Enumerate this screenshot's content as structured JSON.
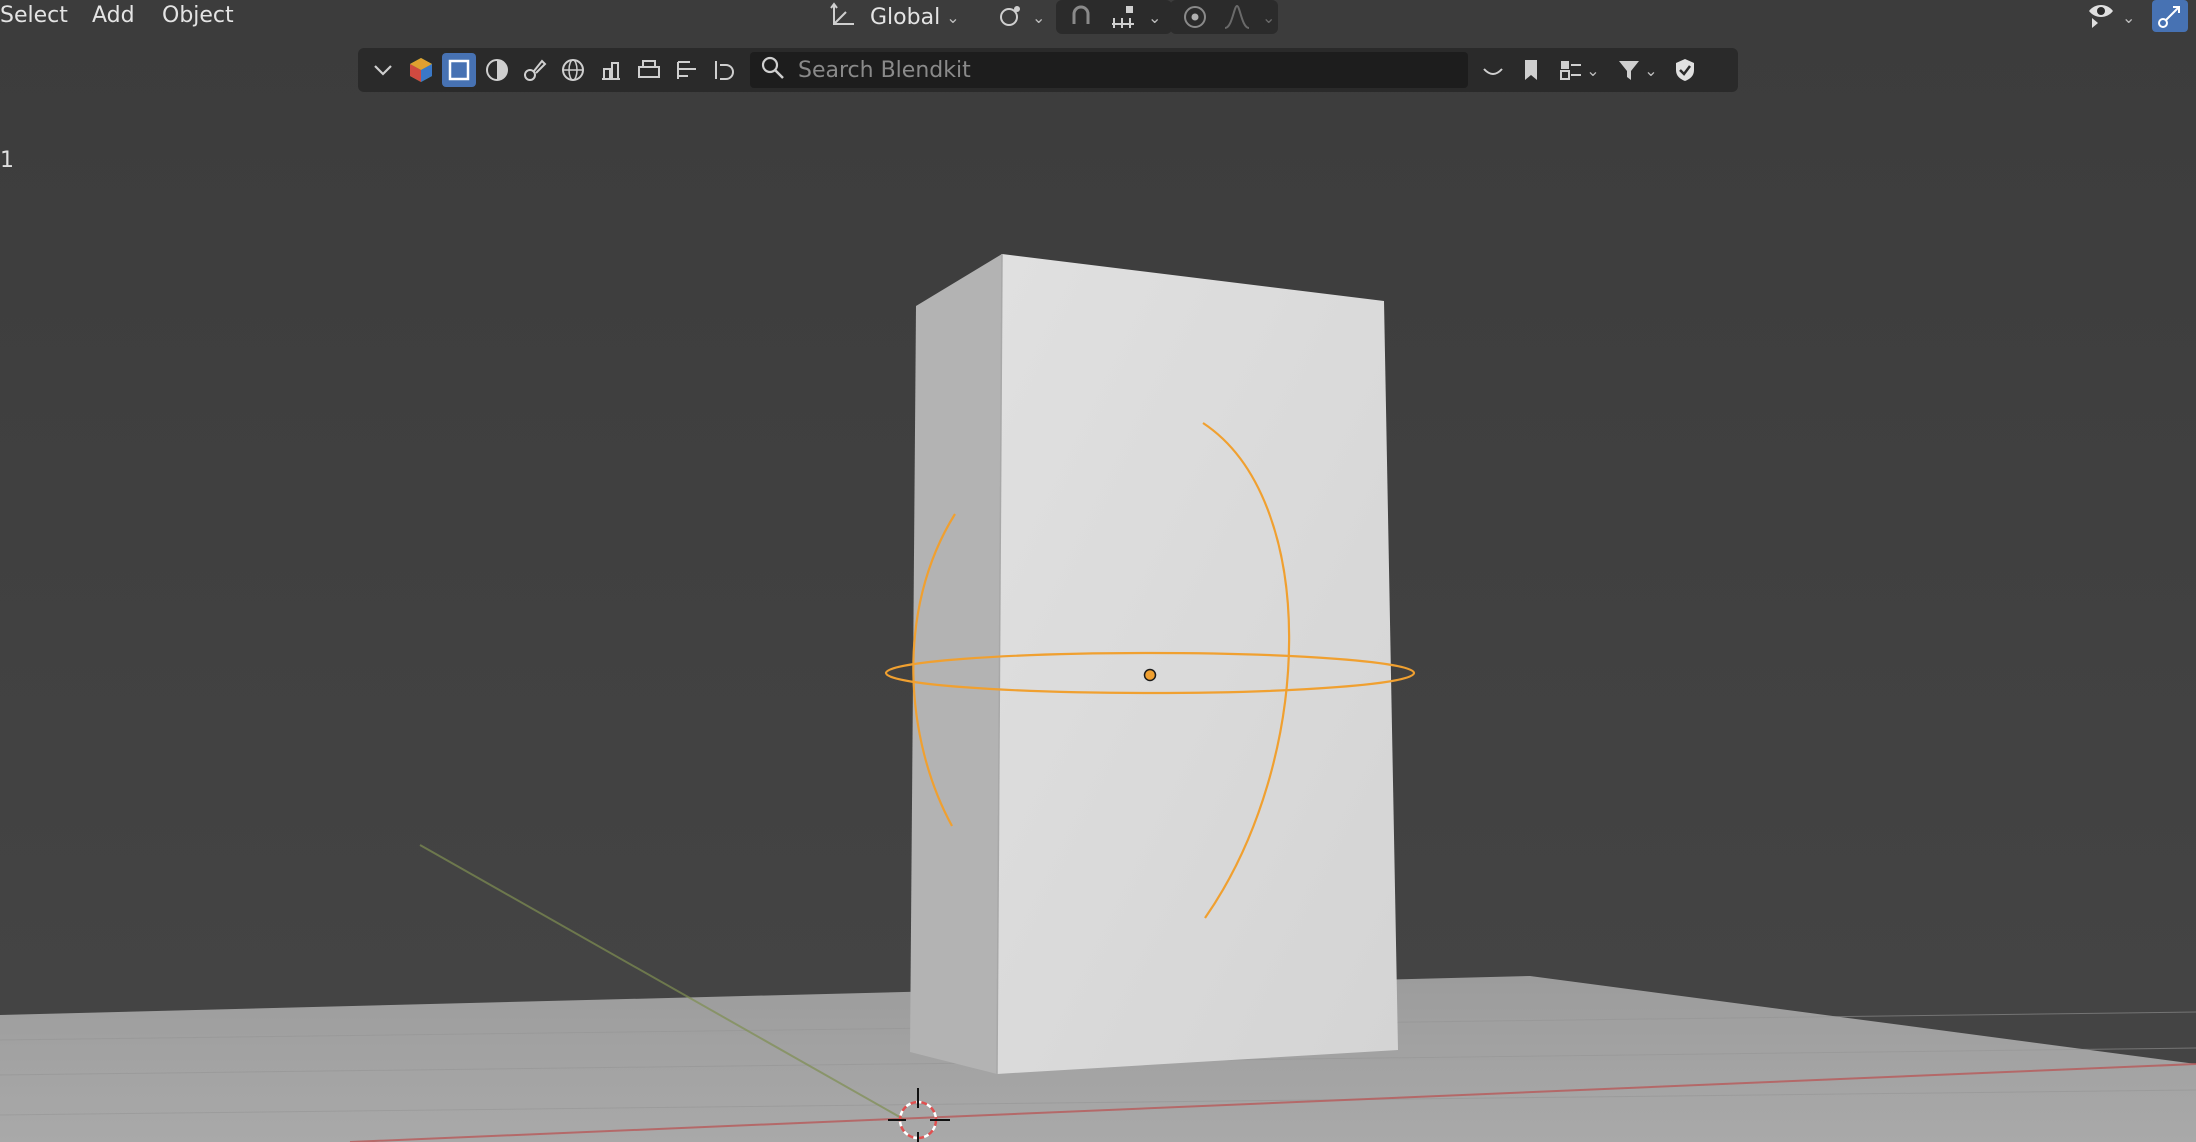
{
  "menu": {
    "select": "Select",
    "add": "Add",
    "object": "Object"
  },
  "header": {
    "orientation_label": "Global"
  },
  "blenderkit": {
    "search_placeholder": "Search Blendkit"
  },
  "viewport": {
    "side_mark": "1"
  },
  "colors": {
    "viewport_bg": "#3d3d3d",
    "floor": "#a3a3a3",
    "box_front": "#d9d9d9",
    "box_side": "#b2b2b2",
    "selection_orange": "#f0a030",
    "accent_blue": "#4772b3",
    "x_axis": "#c0504d",
    "y_axis": "#8aa040"
  },
  "icons": [
    "chevron-down-icon",
    "blenderkit-logo-icon",
    "model-icon",
    "material-icon",
    "brush-icon",
    "hdr-icon",
    "scene-icon",
    "printable-icon",
    "nodegroup-icon",
    "addon-icon",
    "search-icon",
    "collapse-icon",
    "bookmark-icon",
    "asset-bar-icon",
    "filter-icon",
    "shield-icon",
    "transform-orientation-icon",
    "pivot-icon",
    "snap-icon",
    "snap-increment-icon",
    "proportional-edit-icon",
    "falloff-icon",
    "visibility-icon",
    "gizmo-icon",
    "3d-cursor-icon"
  ]
}
